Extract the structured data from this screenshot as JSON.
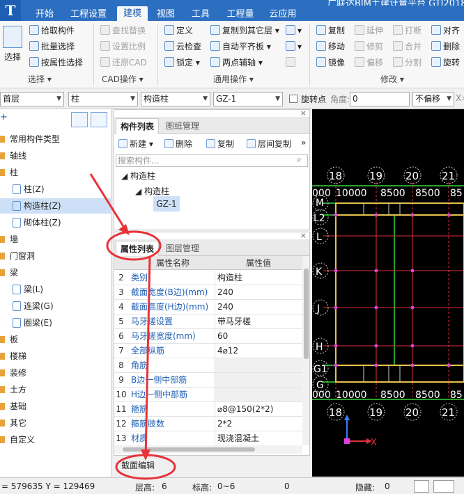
{
  "app": {
    "title": "广联达BIM土建计量平台 GTJ2018",
    "logo": "T"
  },
  "menu_tabs": [
    "开始",
    "工程设置",
    "建模",
    "视图",
    "工具",
    "工程量",
    "云应用"
  ],
  "active_tab": "建模",
  "ribbon": {
    "select_label": "选择",
    "select_group": {
      "items": [
        "拾取构件",
        "批量选择",
        "按属性选择"
      ],
      "group_label": "选择"
    },
    "cad_group": {
      "items": [
        "查找替换",
        "设置比例",
        "还原CAD"
      ],
      "group_label": "CAD操作"
    },
    "common_group": {
      "col1": [
        "定义",
        "云检查",
        "锁定"
      ],
      "col2": [
        "复制到其它层",
        "自动平齐板",
        "两点辅轴"
      ],
      "group_label": "通用操作"
    },
    "modify_group": {
      "col1": [
        "复制",
        "移动",
        "镜像"
      ],
      "col2": [
        "延伸",
        "修剪",
        "偏移"
      ],
      "col3": [
        "打断",
        "合并",
        "分割"
      ],
      "col4": [
        "对齐",
        "删除",
        "旋转"
      ],
      "group_label": "修改"
    }
  },
  "toolbar2": {
    "floor": "首层",
    "category": "柱",
    "type": "构造柱",
    "component": "GZ-1",
    "rotate_point_label": "旋转点",
    "angle_label": "角度:",
    "angle_value": "0",
    "offset": "不偏移",
    "x_label": "X="
  },
  "tree": {
    "items": [
      {
        "label": "常用构件类型"
      },
      {
        "label": "轴线"
      },
      {
        "label": "柱"
      },
      {
        "label": "柱(Z)"
      },
      {
        "label": "构造柱(Z)"
      },
      {
        "label": "砌体柱(Z)"
      },
      {
        "label": "墙"
      },
      {
        "label": "门窗洞"
      },
      {
        "label": "梁"
      },
      {
        "label": "梁(L)"
      },
      {
        "label": "连梁(G)"
      },
      {
        "label": "圈梁(E)"
      },
      {
        "label": "板"
      },
      {
        "label": "楼梯"
      },
      {
        "label": "装修"
      },
      {
        "label": "土方"
      },
      {
        "label": "基础"
      },
      {
        "label": "其它"
      },
      {
        "label": "自定义"
      }
    ]
  },
  "component_panel": {
    "tabs": [
      "构件列表",
      "图纸管理"
    ],
    "tools": [
      "新建",
      "删除",
      "复制",
      "层间复制"
    ],
    "search_placeholder": "搜索构件...",
    "tree": [
      "构造柱",
      "构造柱",
      "GZ-1"
    ]
  },
  "attribute_panel": {
    "tabs": [
      "属性列表",
      "图层管理"
    ],
    "col_name": "属性名称",
    "col_value": "属性值",
    "rows": [
      {
        "no": "2",
        "name": "类别",
        "value": "构造柱"
      },
      {
        "no": "3",
        "name": "截面宽度(B边)(mm)",
        "value": "240"
      },
      {
        "no": "4",
        "name": "截面高度(H边)(mm)",
        "value": "240"
      },
      {
        "no": "5",
        "name": "马牙槎设置",
        "value": "带马牙槎"
      },
      {
        "no": "6",
        "name": "马牙槎宽度(mm)",
        "value": "60"
      },
      {
        "no": "7",
        "name": "全部纵筋",
        "value": "4⌀12"
      },
      {
        "no": "8",
        "name": "角筋",
        "value": ""
      },
      {
        "no": "9",
        "name": "B边一侧中部筋",
        "value": ""
      },
      {
        "no": "10",
        "name": "H边一侧中部筋",
        "value": ""
      },
      {
        "no": "11",
        "name": "箍筋",
        "value": "⌀8@150(2*2)"
      },
      {
        "no": "12",
        "name": "箍筋肢数",
        "value": "2*2"
      },
      {
        "no": "13",
        "name": "材质",
        "value": "现浇混凝土"
      }
    ],
    "section_edit": "截面编辑"
  },
  "canvas": {
    "axis_numbers": [
      "18",
      "19",
      "20",
      "21"
    ],
    "dims": [
      "000",
      "10000",
      "8500",
      "8500",
      "85"
    ],
    "axis_letters": [
      "M",
      "L2",
      "L",
      "K",
      "J",
      "H",
      "G1",
      "G"
    ],
    "x_axis": "X",
    "colors": {
      "bg": "#000000",
      "grid": "#39d63a",
      "wall": "#e8c14a",
      "red": "#e0303a",
      "magenta": "#e040e0"
    }
  },
  "status": {
    "coords": "= 579635 Y = 129469",
    "floor_height_label": "层高:",
    "floor_height": "6",
    "elev_label": "标高:",
    "elev": "0~6",
    "count": "0",
    "hidden_label": "隐藏:",
    "hidden": "0"
  }
}
